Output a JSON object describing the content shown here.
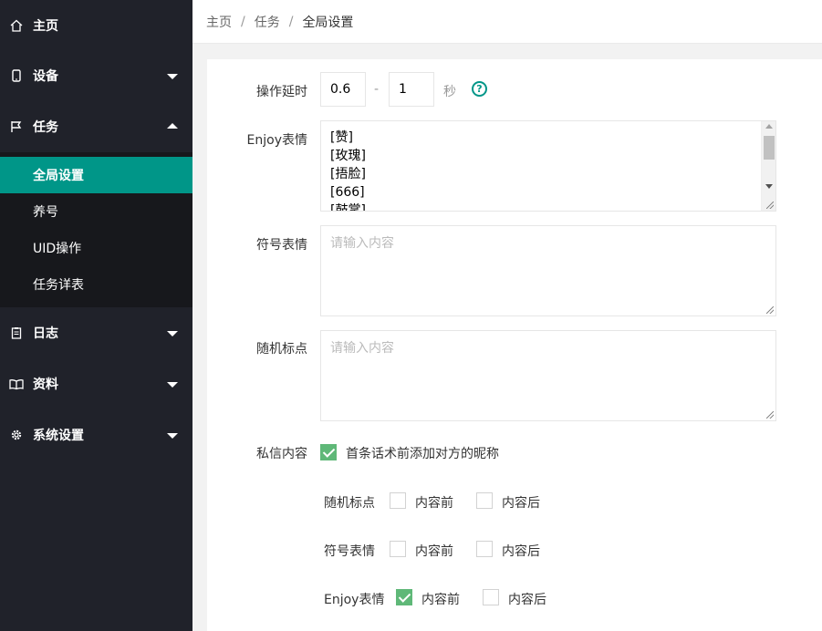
{
  "sidebar": {
    "items": [
      {
        "label": "主页",
        "icon": "home-icon"
      },
      {
        "label": "设备",
        "icon": "device-icon"
      },
      {
        "label": "任务",
        "icon": "flag-icon"
      },
      {
        "label": "日志",
        "icon": "clipboard-icon"
      },
      {
        "label": "资料",
        "icon": "book-icon"
      },
      {
        "label": "系统设置",
        "icon": "gear-icon"
      }
    ],
    "task_subitems": [
      {
        "label": "全局设置",
        "active": true
      },
      {
        "label": "养号"
      },
      {
        "label": "UID操作"
      },
      {
        "label": "任务详表"
      }
    ]
  },
  "breadcrumb": [
    "主页",
    "任务",
    "全局设置"
  ],
  "breadcrumb_sep": "/",
  "form": {
    "delay": {
      "label": "操作延时",
      "min": "0.6",
      "max": "1",
      "dash": "-",
      "unit": "秒",
      "help": "?"
    },
    "enjoy": {
      "label": "Enjoy表情",
      "lines": [
        "[赞]",
        "[玫瑰]",
        "[捂脸]",
        "[666]",
        "[鼓掌]"
      ]
    },
    "symbol": {
      "label": "符号表情",
      "placeholder": "请输入内容"
    },
    "punct": {
      "label": "随机标点",
      "placeholder": "请输入内容"
    },
    "dm": {
      "label": "私信内容",
      "checkbox_label": "首条话术前添加对方的昵称",
      "checked": true
    },
    "rows": [
      {
        "label": "随机标点",
        "before": "内容前",
        "after": "内容后",
        "before_checked": false,
        "after_checked": false
      },
      {
        "label": "符号表情",
        "before": "内容前",
        "after": "内容后",
        "before_checked": false,
        "after_checked": false
      },
      {
        "label": "Enjoy表情",
        "before": "内容前",
        "after": "内容后",
        "before_checked": true,
        "after_checked": false
      }
    ]
  },
  "colors": {
    "accent": "#009688",
    "checkbox": "#5fb878",
    "sidebar_bg": "#20222a",
    "subnav_bg": "#17181c"
  }
}
